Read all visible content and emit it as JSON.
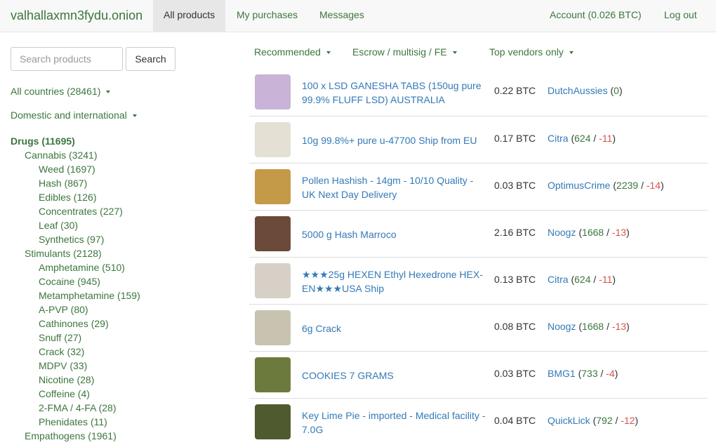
{
  "brand": "valhallaxmn3fydu.onion",
  "nav": {
    "all_products": "All products",
    "my_purchases": "My purchases",
    "messages": "Messages",
    "account": "Account (0.026 BTC)",
    "logout": "Log out"
  },
  "search": {
    "placeholder": "Search products",
    "button": "Search"
  },
  "filters": {
    "countries": "All countries (28461)",
    "shipping": "Domestic and international"
  },
  "sort": {
    "recommended": "Recommended",
    "escrow": "Escrow / multisig / FE",
    "vendors": "Top vendors only"
  },
  "categories": [
    {
      "label": "Drugs (11695)",
      "level": 0
    },
    {
      "label": "Cannabis (3241)",
      "level": 1
    },
    {
      "label": "Weed (1697)",
      "level": 2
    },
    {
      "label": "Hash (867)",
      "level": 2
    },
    {
      "label": "Edibles (126)",
      "level": 2
    },
    {
      "label": "Concentrates (227)",
      "level": 2
    },
    {
      "label": "Leaf (30)",
      "level": 2
    },
    {
      "label": "Synthetics (97)",
      "level": 2
    },
    {
      "label": "Stimulants (2128)",
      "level": 1
    },
    {
      "label": "Amphetamine (510)",
      "level": 2
    },
    {
      "label": "Cocaine (945)",
      "level": 2
    },
    {
      "label": "Metamphetamine (159)",
      "level": 2
    },
    {
      "label": "A-PVP (80)",
      "level": 2
    },
    {
      "label": "Cathinones (29)",
      "level": 2
    },
    {
      "label": "Snuff (27)",
      "level": 2
    },
    {
      "label": "Crack (32)",
      "level": 2
    },
    {
      "label": "MDPV (33)",
      "level": 2
    },
    {
      "label": "Nicotine (28)",
      "level": 2
    },
    {
      "label": "Coffeine (4)",
      "level": 2
    },
    {
      "label": "2-FMA / 4-FA (28)",
      "level": 2
    },
    {
      "label": "Phenidates (11)",
      "level": 2
    },
    {
      "label": "Empathogens (1961)",
      "level": 1
    }
  ],
  "listings": [
    {
      "title": "100 x LSD GANESHA TABS (150ug pure 99.9% FLUFF LSD) AUSTRALIA",
      "price": "0.22 BTC",
      "vendor": "DutchAussies",
      "pos": "0",
      "neg": "",
      "thumb": "#c9b3d6"
    },
    {
      "title": "10g 99.8%+ pure u-47700 Ship from EU",
      "price": "0.17 BTC",
      "vendor": "Citra",
      "pos": "624",
      "neg": "-11",
      "thumb": "#e4e0d4"
    },
    {
      "title": "Pollen Hashish - 14gm - 10/10 Quality - UK Next Day Delivery",
      "price": "0.03 BTC",
      "vendor": "OptimusCrime",
      "pos": "2239",
      "neg": "-14",
      "thumb": "#c49a48"
    },
    {
      "title": "5000 g Hash Marroco",
      "price": "2.16 BTC",
      "vendor": "Noogz",
      "pos": "1668",
      "neg": "-13",
      "thumb": "#6b4a3a"
    },
    {
      "title": "★★★25g HEXEN Ethyl Hexedrone HEX-EN★★★USA Ship",
      "price": "0.13 BTC",
      "vendor": "Citra",
      "pos": "624",
      "neg": "-11",
      "thumb": "#d6d0c6"
    },
    {
      "title": "6g Crack",
      "price": "0.08 BTC",
      "vendor": "Noogz",
      "pos": "1668",
      "neg": "-13",
      "thumb": "#c8c2b0"
    },
    {
      "title": "COOKIES 7 GRAMS",
      "price": "0.03 BTC",
      "vendor": "BMG1",
      "pos": "733",
      "neg": "-4",
      "thumb": "#6d7a3d"
    },
    {
      "title": "Key Lime Pie - imported - Medical facility - 7.0G",
      "price": "0.04 BTC",
      "vendor": "QuickLick",
      "pos": "792",
      "neg": "-12",
      "thumb": "#4f5a2e"
    }
  ]
}
